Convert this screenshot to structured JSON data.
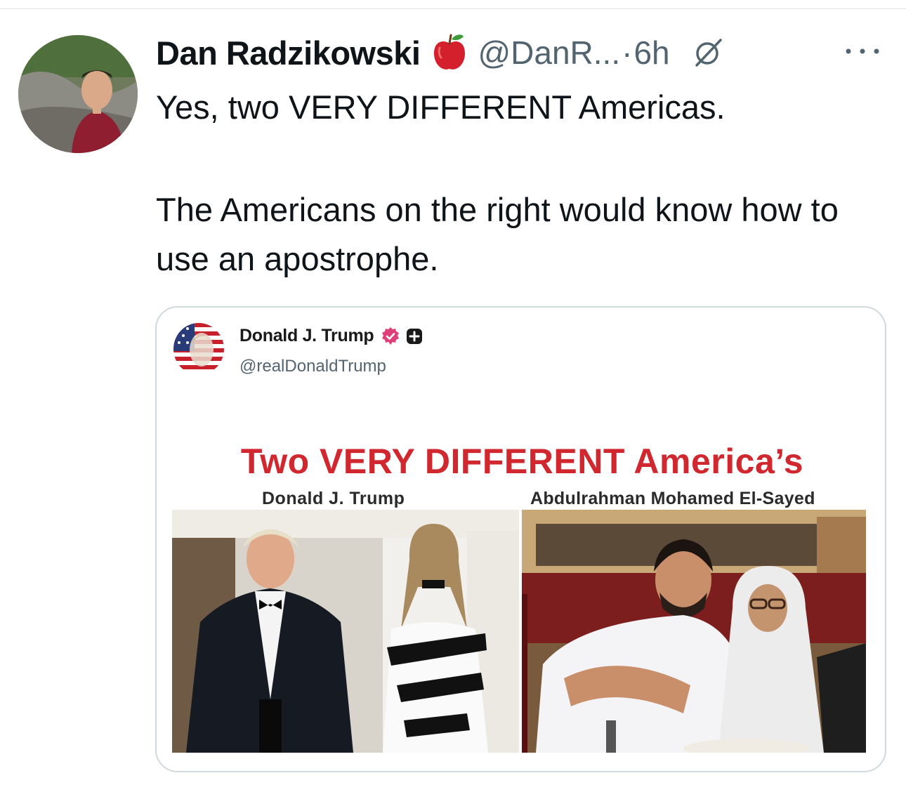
{
  "tweet": {
    "author_name": "Dan Radzikowski",
    "author_badge_icon": "red-apple-icon",
    "handle": "@DanR...",
    "separator": "·",
    "timestamp": "6h",
    "text_line_1": "Yes, two VERY DIFFERENT Americas.",
    "text_para_2": "The Americans on the right would know how to use an apostrophe."
  },
  "quoted_post": {
    "author_name": "Donald J. Trump",
    "handle": "@realDonaldTrump",
    "image": {
      "title": "Two VERY DIFFERENT America’s",
      "caption_left": "Donald J. Trump",
      "caption_right": "Abdulrahman Mohamed El-Sayed"
    }
  },
  "colors": {
    "text_primary": "#0f1419",
    "text_secondary": "#536471",
    "graphic_title_red": "#d0282e",
    "border": "#cfd9de"
  }
}
